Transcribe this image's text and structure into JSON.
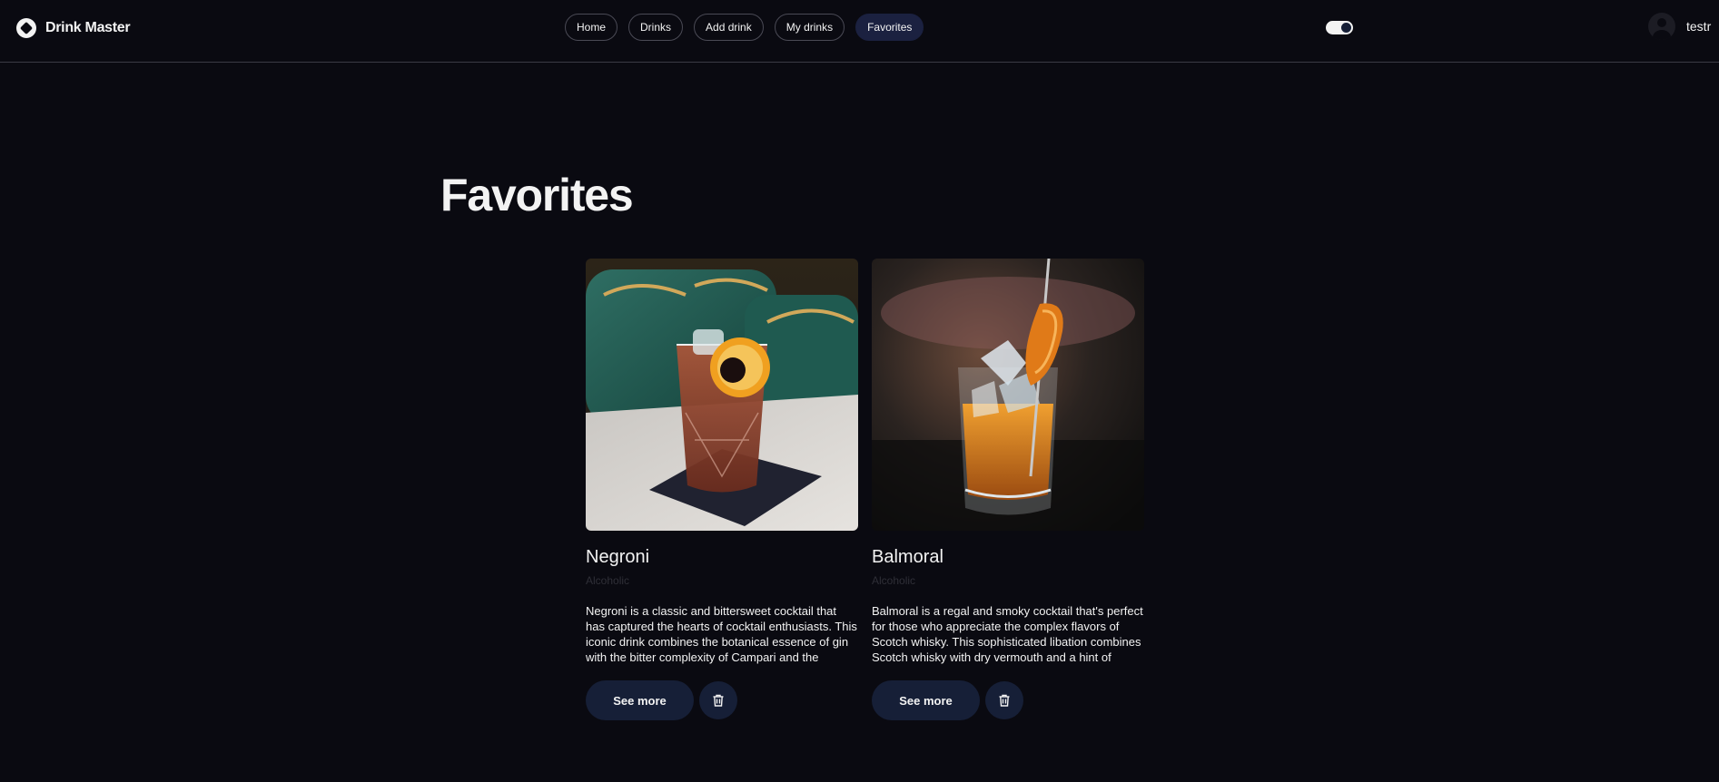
{
  "app": {
    "name": "Drink Master"
  },
  "nav": {
    "items": [
      {
        "label": "Home"
      },
      {
        "label": "Drinks"
      },
      {
        "label": "Add drink"
      },
      {
        "label": "My drinks"
      },
      {
        "label": "Favorites",
        "active": true
      }
    ]
  },
  "theme_toggle": {
    "state": "on"
  },
  "user": {
    "name": "testr"
  },
  "page": {
    "title": "Favorites"
  },
  "cards": [
    {
      "title": "Negroni",
      "category": "Alcoholic",
      "description": "Negroni is a classic and bittersweet cocktail that has captured the hearts of cocktail enthusiasts. This iconic drink combines the botanical essence of gin with the bitter complexity of Campari and the",
      "see_more_label": "See more",
      "image_icon": "negroni-photo",
      "delete_icon": "trash-icon"
    },
    {
      "title": "Balmoral",
      "category": "Alcoholic",
      "description": "Balmoral is a regal and smoky cocktail that's perfect for those who appreciate the complex flavors of Scotch whisky. This sophisticated libation combines Scotch whisky with dry vermouth and a hint of",
      "see_more_label": "See more",
      "image_icon": "balmoral-photo",
      "delete_icon": "trash-icon"
    }
  ],
  "colors": {
    "background": "#0a0a11",
    "text": "#f3f3f3",
    "accent": "#161f37",
    "muted": "#2f2f37"
  }
}
